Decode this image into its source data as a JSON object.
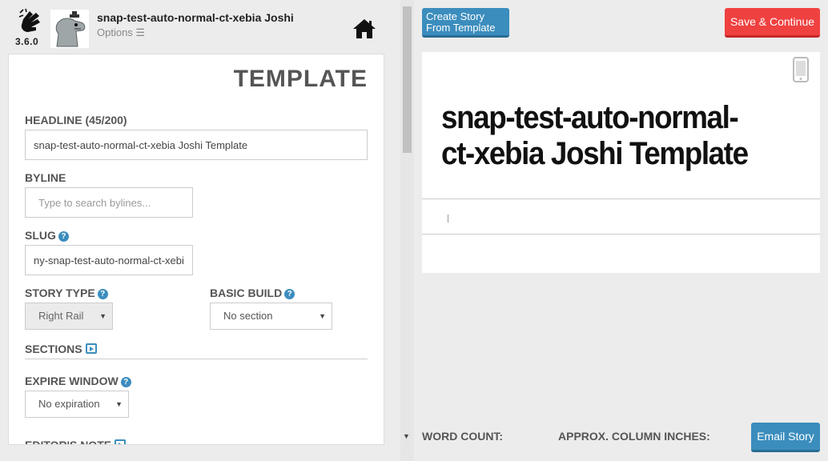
{
  "header": {
    "version": "3.6.0",
    "story_title": "snap-test-auto-normal-ct-xebia Joshi",
    "options_label": "Options ☰"
  },
  "form": {
    "panel_title": "TEMPLATE",
    "headline_label": "HEADLINE (45/200)",
    "headline_value": "snap-test-auto-normal-ct-xebia Joshi Template",
    "byline_label": "BYLINE",
    "byline_placeholder": "Type to search bylines...",
    "slug_label": "SLUG",
    "slug_value": "ny-snap-test-auto-normal-ct-xebia",
    "story_type_label": "STORY TYPE",
    "story_type_value": "Right Rail",
    "basic_build_label": "BASIC BUILD",
    "basic_build_value": "No section",
    "sections_label": "SECTIONS",
    "expire_window_label": "EXPIRE WINDOW",
    "expire_window_value": "No expiration",
    "editors_note_label": "EDITOR'S NOTE"
  },
  "toolbar": {
    "create_template_line1": "Create Story",
    "create_template_line2": "From Template",
    "save_label": "Save & Continue",
    "email_label": "Email Story"
  },
  "preview": {
    "headline": "snap-test-auto-normal-ct-xebia Joshi Template"
  },
  "footer": {
    "word_count_label": "WORD COUNT:",
    "column_inches_label": "APPROX. COLUMN INCHES:"
  },
  "colors": {
    "accent_blue": "#3b8dbd",
    "save_red": "#f04141"
  },
  "icons": {
    "logo": "hand-gesture-icon",
    "avatar": "dinosaur-avatar",
    "home": "home-icon",
    "device": "mobile-device-icon"
  }
}
